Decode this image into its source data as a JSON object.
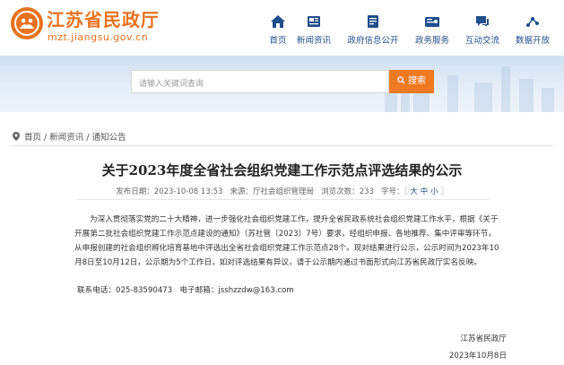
{
  "site": {
    "title": "江苏省民政厅",
    "domain": "mzt.jiangsu.gov.cn"
  },
  "nav": {
    "items": [
      {
        "label": "首页",
        "icon": "home-icon"
      },
      {
        "label": "新闻资讯",
        "icon": "news-icon"
      },
      {
        "label": "政府信息公开",
        "icon": "info-icon"
      },
      {
        "label": "政务服务",
        "icon": "service-icon"
      },
      {
        "label": "互动交流",
        "icon": "chat-icon"
      },
      {
        "label": "数据开放",
        "icon": "data-icon"
      }
    ]
  },
  "search": {
    "placeholder": "请输入关键词查询",
    "button_label": "搜索"
  },
  "breadcrumb": {
    "home": "首页",
    "sep1": "/",
    "news": "新闻资讯",
    "sep2": "/",
    "notice": "通知公告"
  },
  "article": {
    "title": "关于2023年度全省社会组织党建工作示范点评选结果的公示",
    "meta": {
      "date_label": "发布日期：",
      "date": "2023-10-08 13:53",
      "source_label": "来源：",
      "source": "厅社会组织管理局",
      "views_label": "浏览次数：",
      "views": "233",
      "font_label": "字号：",
      "font_open": "〖",
      "font_large": "大",
      "font_medium": "中",
      "font_small": "小",
      "font_close": "〗"
    },
    "paragraph": "为深入贯彻落实党的二十大精神，进一步强化社会组织党建工作，提升全省民政系统社会组织党建工作水平，根据《关于开展第二批社会组织党建工作示范点建设的通知》（苏社管〔2023〕7号）要求，经组织申报、各地推荐、集中评审等环节，从申报创建的社会组织孵化培育基地中评选出全省社会组织党建工作示范点28个。现对结果进行公示，公示时间为2023年10月8日至10月12日，公示期为5个工作日，如对评选结果有异议，请于公示期内通过书面形式向江苏省民政厅实名反映。",
    "contact_phone_label": "联系电话：",
    "contact_phone": "025-83590473",
    "contact_email_label": "电子邮箱：",
    "contact_email": "jsshzzdw@163.com",
    "sign_org": "江苏省民政厅",
    "sign_date": "2023年10月8日"
  },
  "colors": {
    "brand_orange": "#e8721e",
    "nav_blue": "#1f4e8c",
    "search_button": "#ee7a21"
  }
}
